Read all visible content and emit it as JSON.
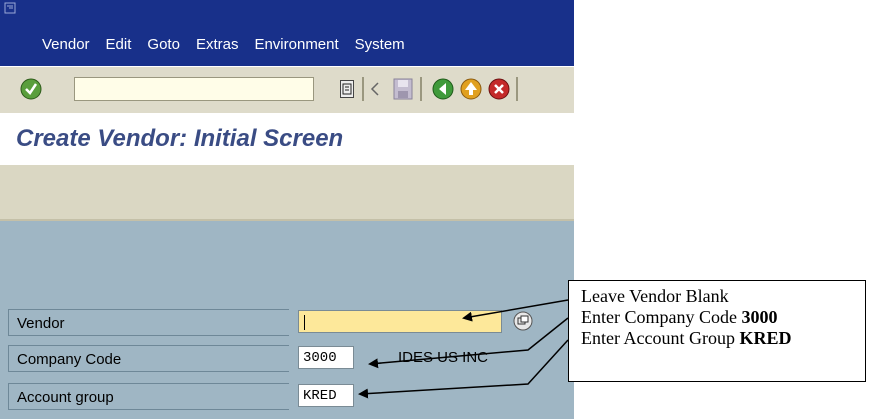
{
  "menu": {
    "items": [
      "Vendor",
      "Edit",
      "Goto",
      "Extras",
      "Environment",
      "System"
    ]
  },
  "toolbar": {
    "command_value": ""
  },
  "page": {
    "title": "Create Vendor: Initial Screen"
  },
  "form": {
    "vendor": {
      "label": "Vendor",
      "value": ""
    },
    "company_code": {
      "label": "Company Code",
      "value": "3000",
      "description": "IDES US INC"
    },
    "account_group": {
      "label": "Account group",
      "value": "KRED"
    }
  },
  "callout": {
    "line1": "Leave Vendor Blank",
    "line2_text": "Enter Company Code",
    "line2_bold": "3000",
    "line3_text": "Enter Account Group",
    "line3_bold": "KRED"
  },
  "colors": {
    "menubar": "#18308a",
    "title": "#3a4c84",
    "main_bg": "#9fb6c4",
    "required_field": "#fde89a"
  }
}
